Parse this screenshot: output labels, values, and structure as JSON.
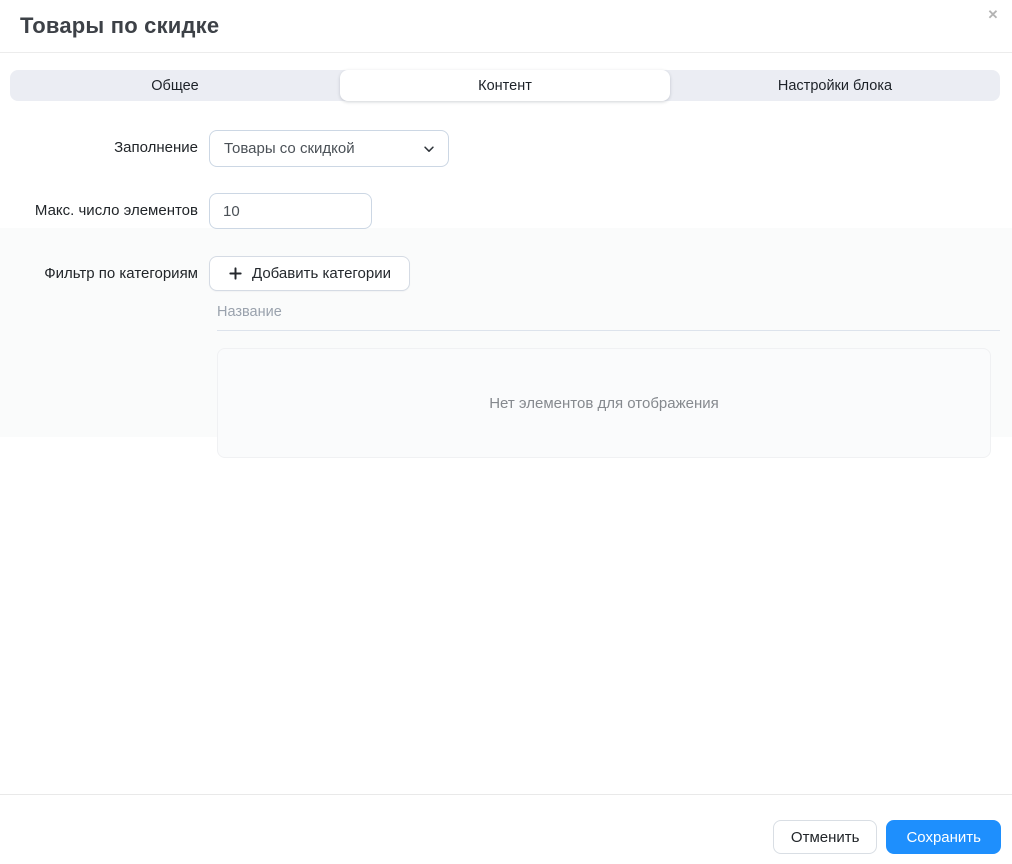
{
  "modal": {
    "title": "Товары по скидке",
    "close_glyph": "✕"
  },
  "tabs": [
    {
      "label": "Общее",
      "active": false
    },
    {
      "label": "Контент",
      "active": true
    },
    {
      "label": "Настройки блока",
      "active": false
    }
  ],
  "form": {
    "fill": {
      "label": "Заполнение",
      "selected_option": "Товары со скидкой"
    },
    "max_items": {
      "label": "Макс. число элементов",
      "value": "10"
    },
    "category_filter": {
      "label": "Фильтр по категориям",
      "add_button_label": "Добавить категории",
      "table": {
        "column_header": "Название",
        "empty_text": "Нет элементов для отображения"
      }
    }
  },
  "footer": {
    "cancel_label": "Отменить",
    "save_label": "Сохранить"
  },
  "colors": {
    "accent_blue": "#1e8ffd",
    "tab_bar_bg": "#ebedf3",
    "muted_text": "#9aa2ad",
    "border_light": "#ccd7e4"
  }
}
